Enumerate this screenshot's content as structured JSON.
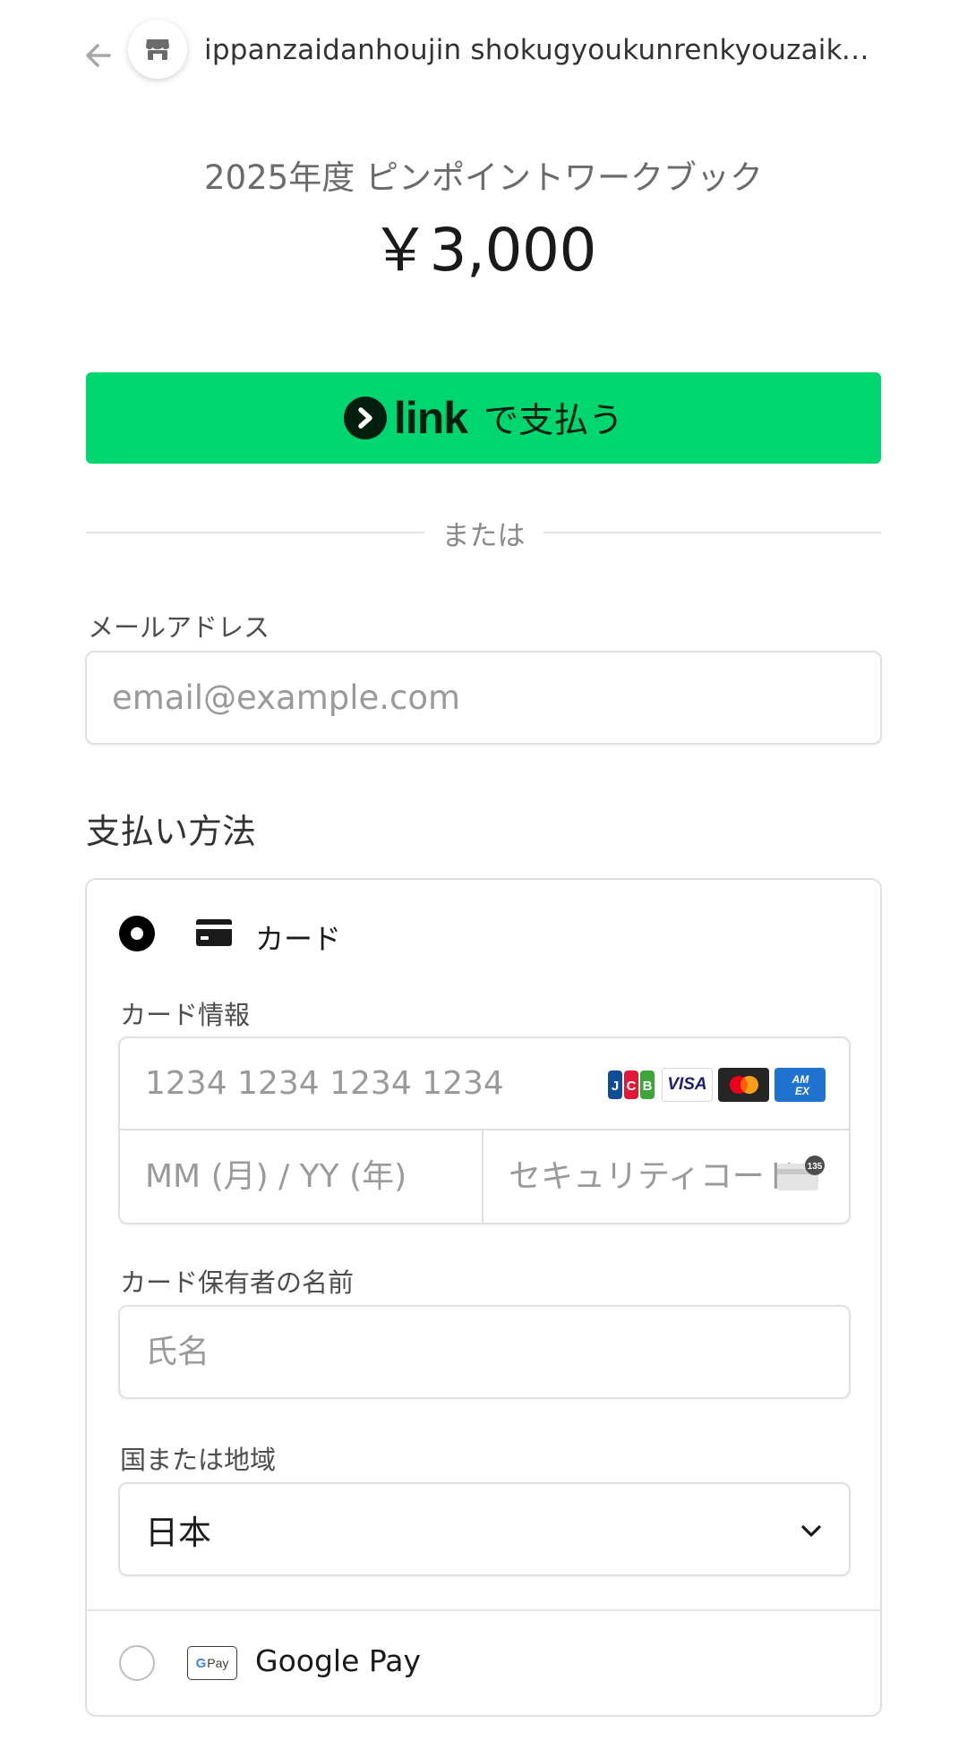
{
  "header": {
    "merchant_name": "ippanzaidanhoujin shokugyoukunrenkyouzaike…"
  },
  "product": {
    "name": "2025年度 ピンポイントワークブック",
    "price": "￥3,000"
  },
  "link_button": {
    "logo_text": "link",
    "label": "で支払う",
    "color": "#00D66F"
  },
  "divider": {
    "text": "または"
  },
  "email": {
    "label": "メールアドレス",
    "placeholder": "email@example.com",
    "value": ""
  },
  "payment": {
    "title": "支払い方法",
    "card_option": {
      "label": "カード",
      "selected": true,
      "card_info_label": "カード情報",
      "number_placeholder": "1234 1234 1234 1234",
      "brands": [
        "JCB",
        "VISA",
        "Mastercard",
        "American Express"
      ],
      "expiry_placeholder": "MM (月) / YY (年)",
      "cvc_placeholder": "セキュリティコード",
      "cvc_icon_text": "135",
      "holder_label": "カード保有者の名前",
      "holder_placeholder": "氏名",
      "country_label": "国または地域",
      "country_value": "日本"
    },
    "gpay_option": {
      "label": "Google Pay",
      "icon_text": "Pay",
      "selected": false
    }
  },
  "icons": {
    "back": "arrow-left-icon",
    "merchant": "store-icon",
    "card": "credit-card-icon",
    "chevron": "chevron-down-icon"
  }
}
